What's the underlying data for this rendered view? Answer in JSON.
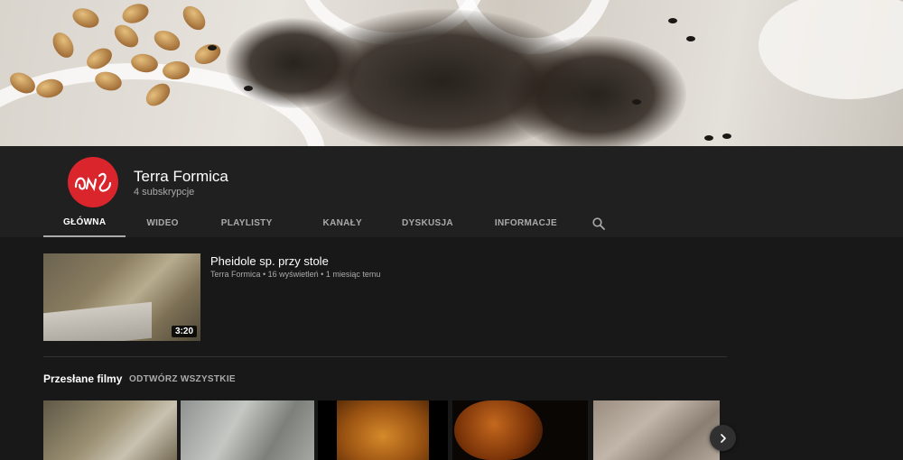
{
  "channel": {
    "name": "Terra Formica",
    "subscribers": "4 subskrypcje"
  },
  "tabs": [
    {
      "label": "GŁÓWNA",
      "active": true
    },
    {
      "label": "WIDEO",
      "active": false
    },
    {
      "label": "PLAYLISTY",
      "active": false
    },
    {
      "label": "KANAŁY",
      "active": false
    },
    {
      "label": "DYSKUSJA",
      "active": false
    },
    {
      "label": "INFORMACJE",
      "active": false
    }
  ],
  "search_icon": "search-icon",
  "featured": {
    "title": "Pheidole sp. przy stole",
    "meta": "Terra Formica • 16 wyświetleń • 1 miesiąc temu",
    "duration": "3:20"
  },
  "shelf": {
    "title": "Przesłane filmy",
    "play_all": "ODTWÓRZ WSZYSTKIE"
  },
  "colors": {
    "background": "#181818",
    "header": "#202020",
    "avatar": "#d9252b",
    "muted_text": "#aaaaaa"
  },
  "next_icon": "chevron-right-icon"
}
